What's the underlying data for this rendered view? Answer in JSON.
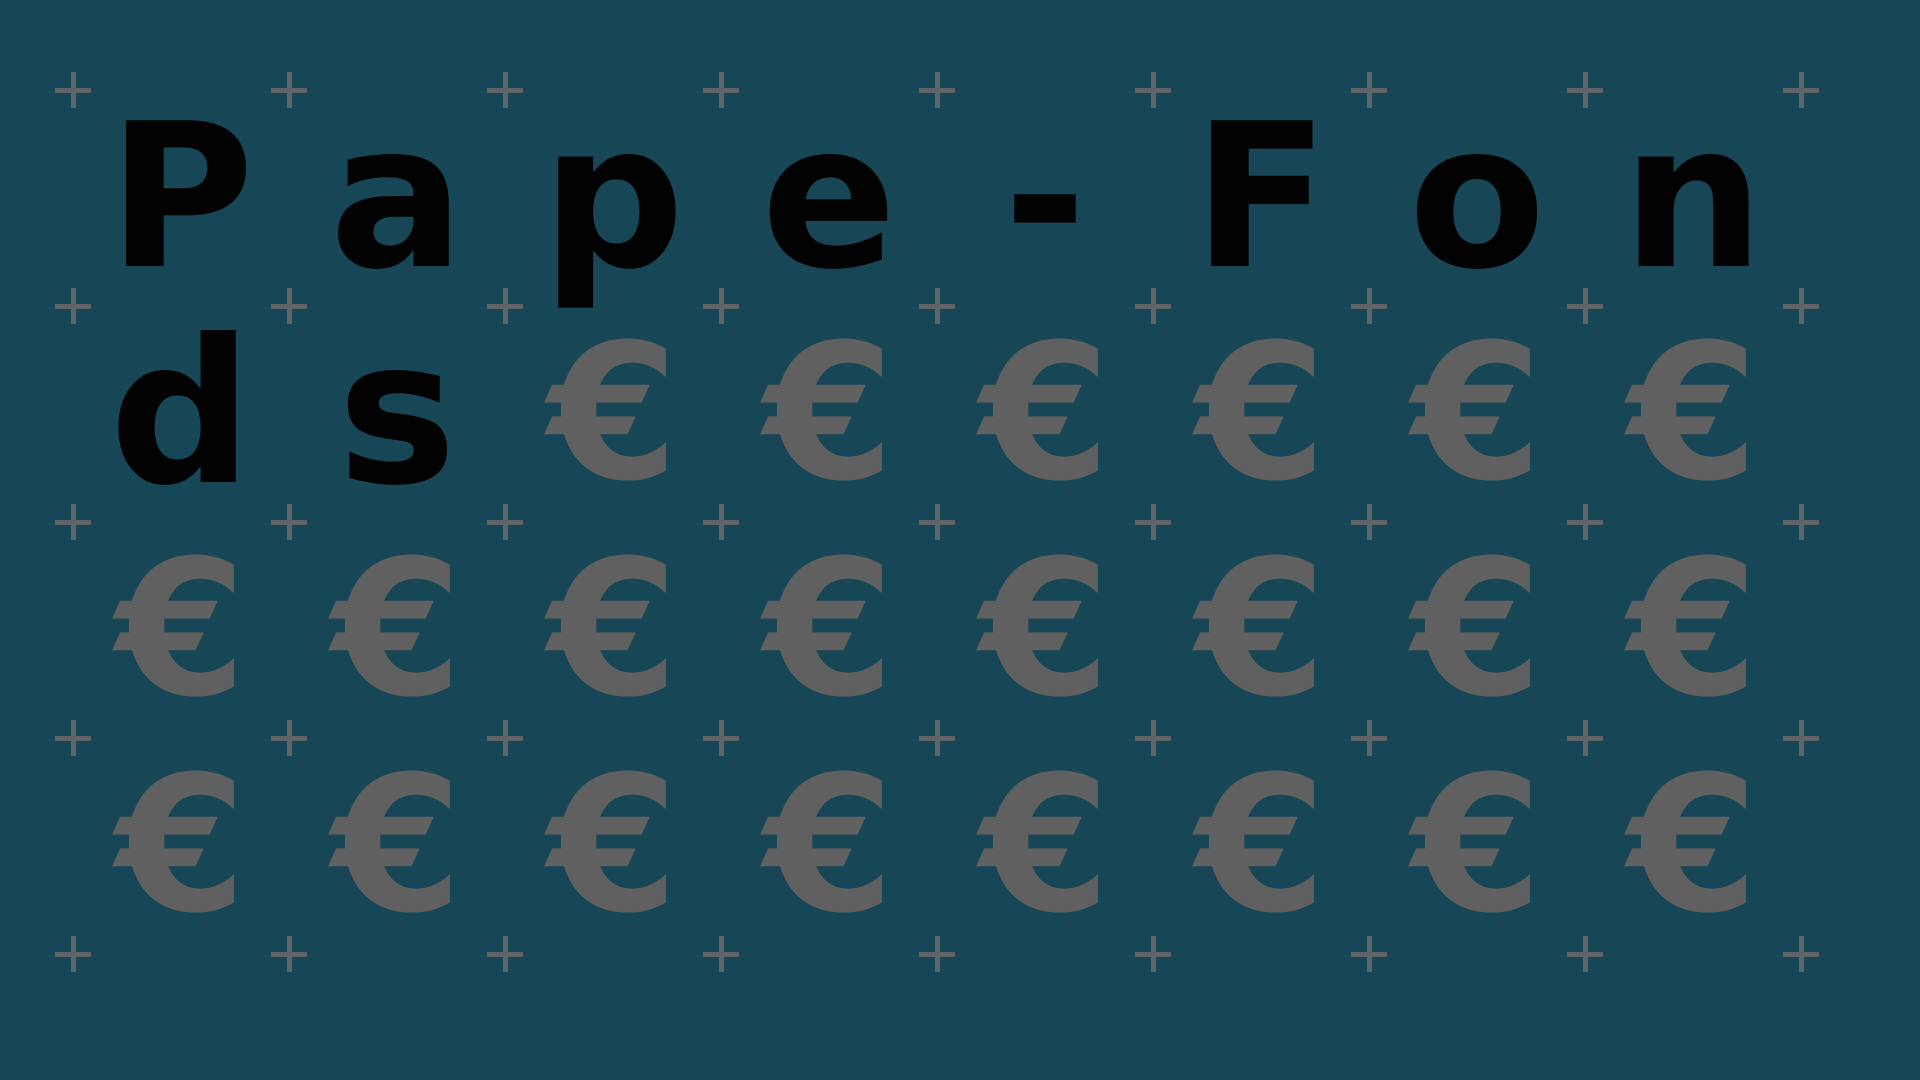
{
  "title_text": "Pape-Fonds",
  "filler_symbol": "€",
  "grid": {
    "columns": 8,
    "rows": 4
  },
  "colors": {
    "background": "#174756",
    "letter": "#020202",
    "filler": "#606060",
    "cross_marker": "#5f6466"
  },
  "icons": {
    "cross_marker": "plus-icon"
  }
}
